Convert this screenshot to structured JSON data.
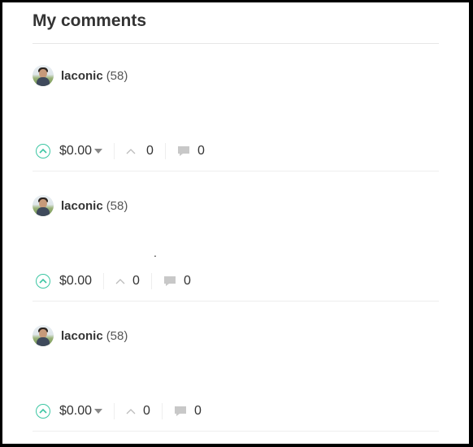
{
  "page": {
    "title": "My comments"
  },
  "comments": [
    {
      "author": "laconic",
      "reputation": "(58)",
      "body": "",
      "payout": "$0.00",
      "payout_dropdown": true,
      "likes": "0",
      "replies": "0"
    },
    {
      "author": "laconic",
      "reputation": "(58)",
      "body": ".",
      "payout": "$0.00",
      "payout_dropdown": false,
      "likes": "0",
      "replies": "0"
    },
    {
      "author": "laconic",
      "reputation": "(58)",
      "body": "",
      "payout": "$0.00",
      "payout_dropdown": true,
      "likes": "0",
      "replies": "0"
    }
  ],
  "icons": {
    "upvote": "upvote-circle-icon",
    "payout_menu": "caret-down-icon",
    "likes": "chevron-up-icon",
    "replies": "speech-bubble-icon"
  },
  "colors": {
    "accent": "#3cc6a3",
    "text": "#333333",
    "muted": "#c8c8c8"
  }
}
